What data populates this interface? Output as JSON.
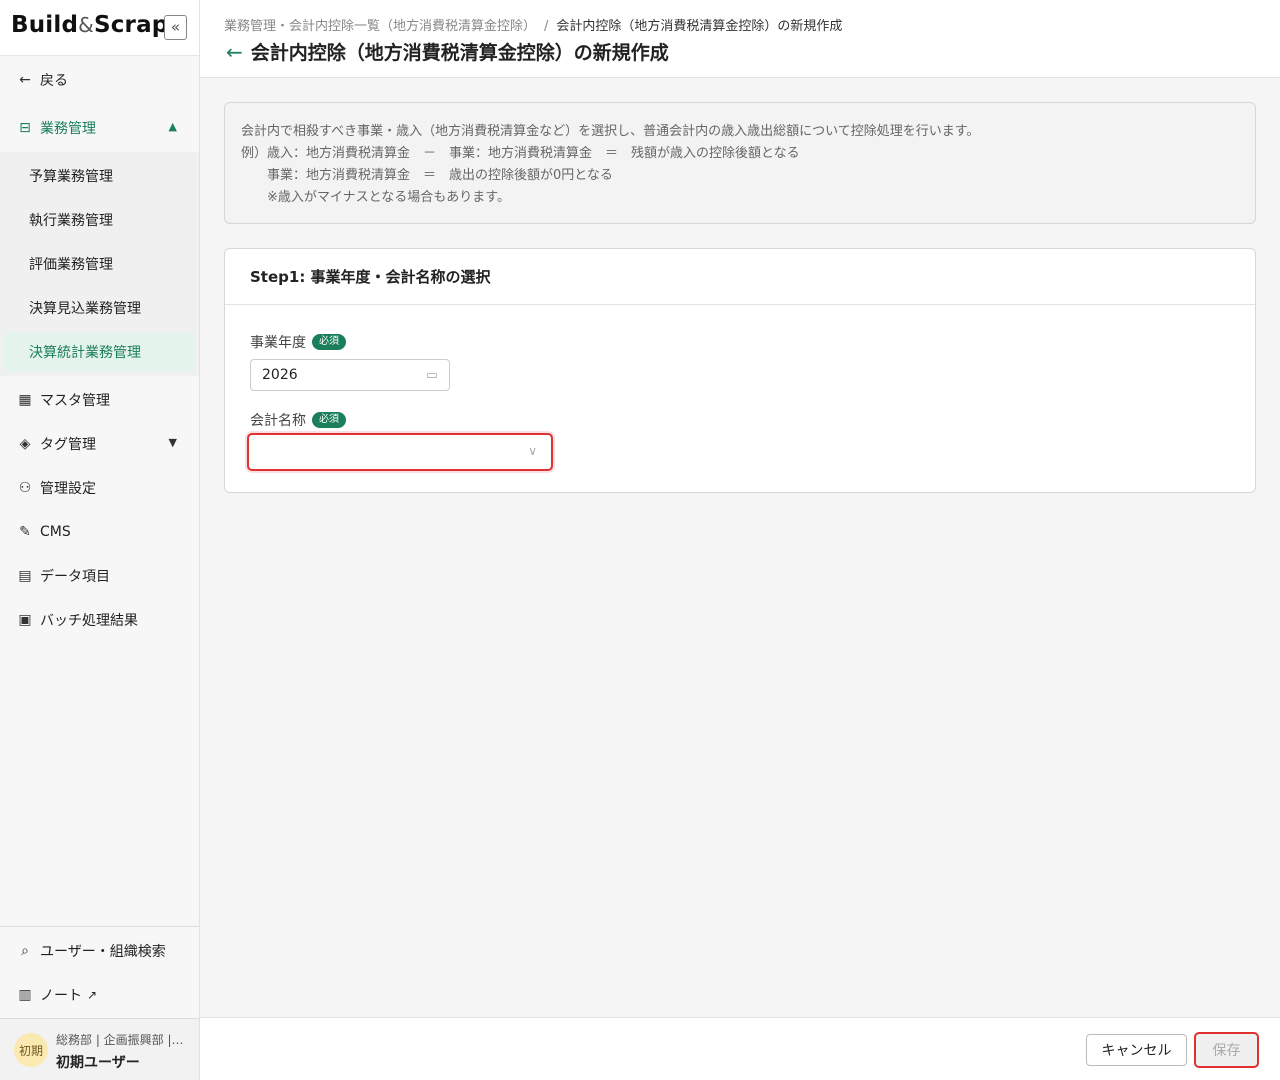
{
  "app": {
    "logo_main": "Build",
    "logo_amp": "&",
    "logo_end": "Scrap",
    "collapse_label": "«"
  },
  "sidebar": {
    "back": {
      "label": "戻る",
      "icon": "arrow-left-icon"
    },
    "group": {
      "label": "業務管理",
      "icon": "task-list-icon",
      "expanded": true
    },
    "sub_items": [
      {
        "label": "予算業務管理",
        "active": false
      },
      {
        "label": "執行業務管理",
        "active": false
      },
      {
        "label": "評価業務管理",
        "active": false
      },
      {
        "label": "決算見込業務管理",
        "active": false
      },
      {
        "label": "決算統計業務管理",
        "active": true
      }
    ],
    "items": [
      {
        "label": "マスタ管理",
        "icon": "table-icon"
      },
      {
        "label": "タグ管理",
        "icon": "tag-icon"
      },
      {
        "label": "管理設定",
        "icon": "user-settings-icon"
      },
      {
        "label": "CMS",
        "icon": "edit-icon"
      },
      {
        "label": "データ項目",
        "icon": "document-icon"
      },
      {
        "label": "バッチ処理結果",
        "icon": "terminal-icon"
      }
    ],
    "bottom_items": [
      {
        "label": "ユーザー・組織検索",
        "icon": "search-icon"
      },
      {
        "label": "ノート",
        "icon": "book-icon"
      }
    ],
    "user": {
      "avatar_text": "初期",
      "org": "総務部 | 企画振興部 | …",
      "name": "初期ユーザー"
    }
  },
  "header": {
    "breadcrumb_parent": "業務管理・会計内控除一覧（地方消費税清算金控除）",
    "breadcrumb_sep": "/",
    "breadcrumb_current": "会計内控除（地方消費税清算金控除）の新規作成",
    "title": "会計内控除（地方消費税清算金控除）の新規作成"
  },
  "info": {
    "lines": [
      "会計内で相殺すべき事業・歳入（地方消費税清算金など）を選択し、普通会計内の歳入歳出総額について控除処理を行います。",
      "例）歳入：地方消費税清算金　－　事業：地方消費税清算金　＝　残額が歳入の控除後額となる",
      "　　事業：地方消費税清算金　＝　歳出の控除後額が0円となる",
      "　　※歳入がマイナスとなる場合もあります。"
    ]
  },
  "step1": {
    "title": "Step1: 事業年度・会計名称の選択",
    "year_label": "事業年度",
    "year_required": "必須",
    "year_value": "2026",
    "account_label": "会計名称",
    "account_required": "必須",
    "account_value": ""
  },
  "footer": {
    "cancel_label": "キャンセル",
    "save_label": "保存"
  },
  "colors": {
    "accent": "#1a7f5a",
    "error": "#e03030"
  }
}
